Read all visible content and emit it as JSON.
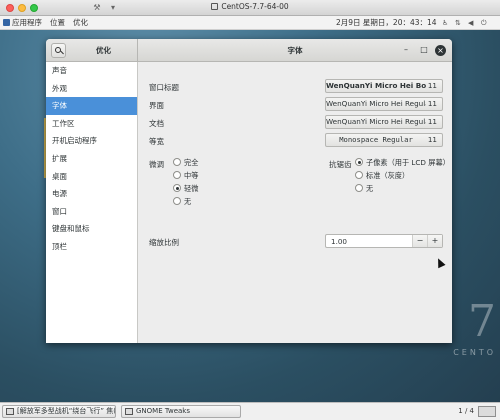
{
  "vm": {
    "title": "CentOS-7.7-64-00",
    "toolbar_icons": [
      "wrench-icon",
      "vm-menu-icon"
    ]
  },
  "top_panel": {
    "applications": "应用程序",
    "places": "位置",
    "active_app": "优化",
    "clock": "2月9日 星期日，20：43：14",
    "status_icons": [
      "accessibility-icon",
      "network-icon",
      "volume-icon",
      "power-icon"
    ]
  },
  "window": {
    "app_title": "优化",
    "page_title": "字体",
    "controls": {
      "minimize": "–",
      "maximize": "□",
      "close": "×"
    }
  },
  "sidebar": {
    "items": [
      {
        "label": "声音",
        "active": false
      },
      {
        "label": "外观",
        "active": false
      },
      {
        "label": "字体",
        "active": true
      },
      {
        "label": "工作区",
        "active": false
      },
      {
        "label": "开机启动程序",
        "active": false
      },
      {
        "label": "扩展",
        "active": false
      },
      {
        "label": "桌面",
        "active": false
      },
      {
        "label": "电源",
        "active": false
      },
      {
        "label": "窗口",
        "active": false
      },
      {
        "label": "键盘和鼠标",
        "active": false
      },
      {
        "label": "顶栏",
        "active": false
      }
    ]
  },
  "fonts": {
    "rows": [
      {
        "label": "窗口标题",
        "font": "WenQuanYi Micro Hei Bold",
        "size": "11",
        "bold": true
      },
      {
        "label": "界面",
        "font": "WenQuanYi Micro Hei Regular",
        "size": "11",
        "bold": false
      },
      {
        "label": "文档",
        "font": "WenQuanYi Micro Hei Regular",
        "size": "11",
        "bold": false
      },
      {
        "label": "等宽",
        "font": "Monospace Regular",
        "size": "11",
        "bold": false
      }
    ]
  },
  "hinting": {
    "label": "微调",
    "options": [
      "完全",
      "中等",
      "轻微",
      "无"
    ],
    "selected": "轻微"
  },
  "antialiasing": {
    "label": "抗锯齿",
    "options": [
      "子像素（用于 LCD 屏幕）",
      "标准（灰度）",
      "无"
    ],
    "selected": "子像素（用于 LCD 屏幕）"
  },
  "scaling": {
    "label": "缩放比例",
    "value": "1.00",
    "minus": "−",
    "plus": "+"
  },
  "taskbar": {
    "tasks": [
      {
        "label": "[解放军多型战机“绕台飞行” 焦()",
        "icon": "browser-window-icon"
      },
      {
        "label": "GNOME Tweaks",
        "icon": "tweaks-window-icon"
      }
    ],
    "pager": "1 / 4"
  },
  "desktop": {
    "logo_numeral": "7",
    "logo_word": "CENTO"
  }
}
